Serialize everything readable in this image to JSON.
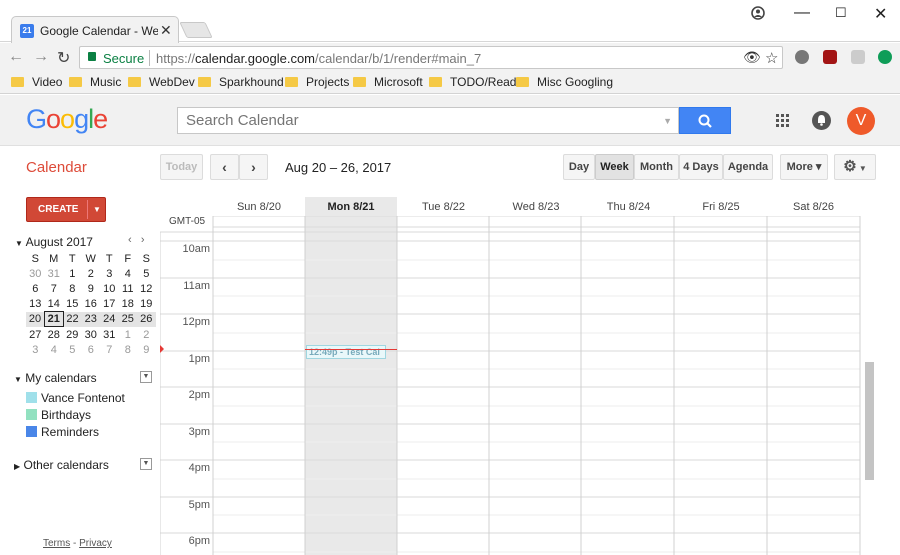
{
  "browser": {
    "tab_title": "Google Calendar - Week",
    "tab_favicon_text": "21",
    "secure_label": "Secure",
    "url_prefix": "https://",
    "url_host": "calendar.google.com",
    "url_path": "/calendar/b/1/render#main_7",
    "bookmarks": [
      "Video",
      "Music",
      "WebDev",
      "Sparkhound",
      "Projects",
      "Microsoft",
      "TODO/Read",
      "Misc Googling"
    ]
  },
  "app": {
    "logo": "Google",
    "search_placeholder": "Search Calendar",
    "avatar_letter": "V",
    "title": "Calendar",
    "today_label": "Today",
    "date_range": "Aug 20 – 26, 2017",
    "views": [
      "Day",
      "Week",
      "Month",
      "4 Days",
      "Agenda"
    ],
    "active_view": "Week",
    "more_label": "More ▾",
    "create_label": "CREATE"
  },
  "minical": {
    "title": "August 2017",
    "weekdays": [
      "S",
      "M",
      "T",
      "W",
      "T",
      "F",
      "S"
    ],
    "weeks": [
      [
        "30",
        "31",
        "1",
        "2",
        "3",
        "4",
        "5"
      ],
      [
        "6",
        "7",
        "8",
        "9",
        "10",
        "11",
        "12"
      ],
      [
        "13",
        "14",
        "15",
        "16",
        "17",
        "18",
        "19"
      ],
      [
        "20",
        "21",
        "22",
        "23",
        "24",
        "25",
        "26"
      ],
      [
        "27",
        "28",
        "29",
        "30",
        "31",
        "1",
        "2"
      ],
      [
        "3",
        "4",
        "5",
        "6",
        "7",
        "8",
        "9"
      ]
    ],
    "selected_week_index": 3,
    "today": "21"
  },
  "sidebar": {
    "my_calendars_label": "My calendars",
    "calendars": [
      {
        "name": "Vance Fontenot",
        "color": "#a0e0ea"
      },
      {
        "name": "Birthdays",
        "color": "#92e1c0"
      },
      {
        "name": "Reminders",
        "color": "#4a86e8"
      }
    ],
    "other_calendars_label": "Other calendars",
    "footer_terms": "Terms",
    "footer_sep": " - ",
    "footer_privacy": "Privacy"
  },
  "grid": {
    "timezone": "GMT-05",
    "days": [
      "Sun 8/20",
      "Mon 8/21",
      "Tue 8/22",
      "Wed 8/23",
      "Thu 8/24",
      "Fri 8/25",
      "Sat 8/26"
    ],
    "today_day": "Mon 8/21",
    "hours": [
      "10am",
      "11am",
      "12pm",
      "1pm",
      "2pm",
      "3pm",
      "4pm",
      "5pm",
      "6pm"
    ],
    "event": {
      "text": "12:49p - Test Cal",
      "day": "Mon 8/21"
    }
  },
  "colors": {
    "accent": "#dd4b39",
    "create": "#d14836",
    "search_button": "#4285f4",
    "now_line": "#e53935"
  }
}
